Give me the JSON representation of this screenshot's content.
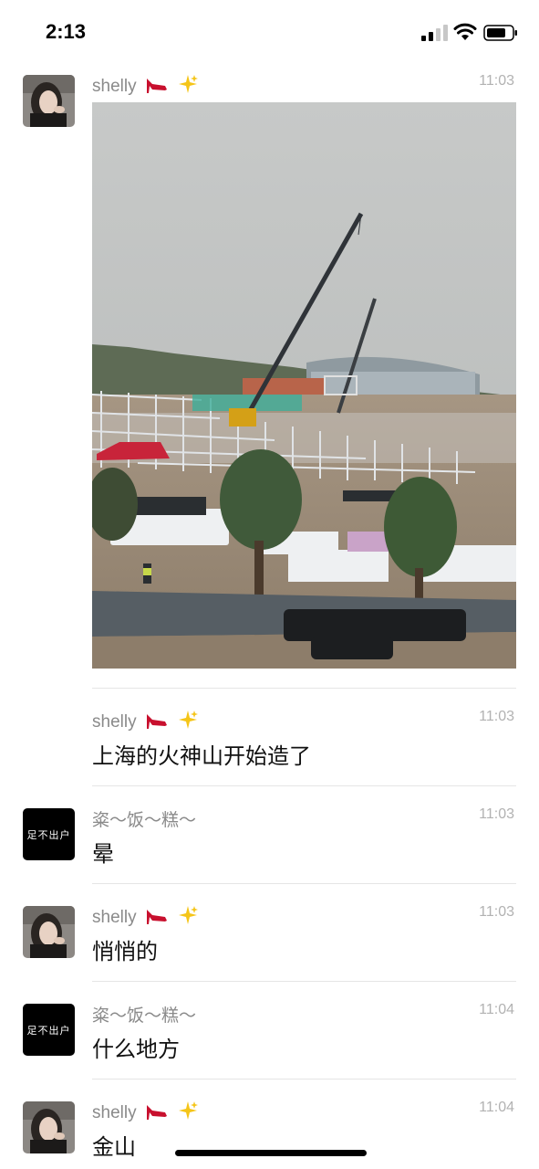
{
  "status_bar": {
    "time": "2:13"
  },
  "colors": {
    "timestamp": "#b2b2b2",
    "sender": "#8a8a8a",
    "divider": "#e5e5e5",
    "home_indicator": "#000000"
  },
  "messages": [
    {
      "sender": "shelly",
      "sender_emojis": [
        "high-heel-icon",
        "sparkles-icon"
      ],
      "time": "11:03",
      "type": "image",
      "text": ""
    },
    {
      "sender": "shelly",
      "sender_emojis": [
        "high-heel-icon",
        "sparkles-icon"
      ],
      "time": "11:03",
      "type": "text",
      "text": "上海的火神山开始造了"
    },
    {
      "sender": "粢～饭～糕～",
      "avatar_text": "足不出户",
      "time": "11:03",
      "type": "text",
      "text": "晕"
    },
    {
      "sender": "shelly",
      "sender_emojis": [
        "high-heel-icon",
        "sparkles-icon"
      ],
      "time": "11:03",
      "type": "text",
      "text": "悄悄的"
    },
    {
      "sender": "粢～饭～糕～",
      "avatar_text": "足不出户",
      "time": "11:04",
      "type": "text",
      "text": "什么地方"
    },
    {
      "sender": "shelly",
      "sender_emojis": [
        "high-heel-icon",
        "sparkles-icon"
      ],
      "time": "11:04",
      "type": "text",
      "text": "金山"
    }
  ]
}
